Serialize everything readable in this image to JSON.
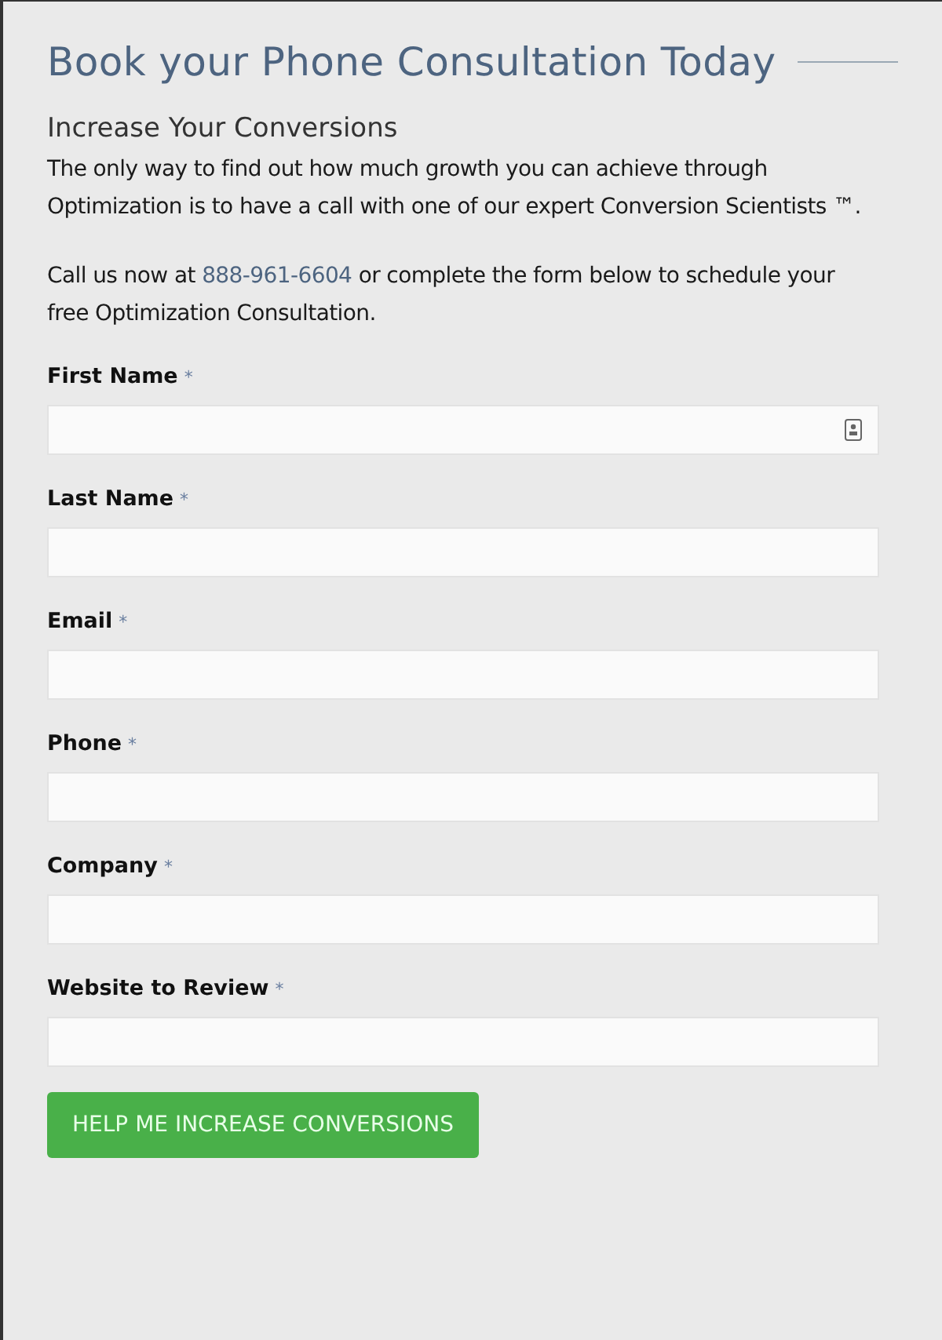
{
  "title": "Book your Phone Consultation Today",
  "subtitle": "Increase Your Conversions",
  "intro": "The only way to find out how much growth you can achieve through Optimization is to have a call with one of our expert Conversion Scientists ™.",
  "call": {
    "before": "Call us now at",
    "phone": "888-961-6604",
    "after": "or complete the form below to schedule your free Optimization Consultation."
  },
  "fields": [
    {
      "label": "First Name",
      "required_mark": "*",
      "autofill_icon": true
    },
    {
      "label": "Last Name",
      "required_mark": "*",
      "autofill_icon": false
    },
    {
      "label": "Email",
      "required_mark": "*",
      "autofill_icon": false
    },
    {
      "label": "Phone",
      "required_mark": "*",
      "autofill_icon": false
    },
    {
      "label": "Company",
      "required_mark": "*",
      "autofill_icon": false
    },
    {
      "label": "Website to Review",
      "required_mark": "*",
      "autofill_icon": false
    }
  ],
  "submit": "HELP ME INCREASE CONVERSIONS"
}
